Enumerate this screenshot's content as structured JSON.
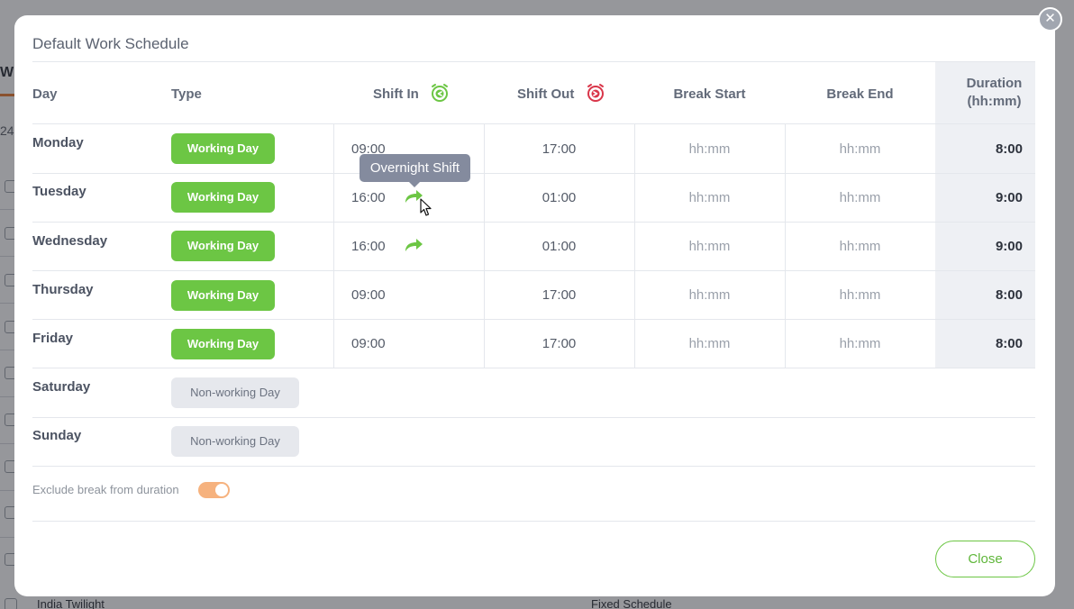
{
  "background": {
    "tab_letter": "W",
    "count_fragment": "24",
    "bottom_left_text": "India Twilight",
    "bottom_right_text": "Fixed Schedule"
  },
  "modal": {
    "title": "Default Work Schedule",
    "close_x": "✕",
    "close_button": "Close"
  },
  "columns": {
    "day": "Day",
    "type": "Type",
    "shift_in": "Shift In",
    "shift_out": "Shift Out",
    "break_start": "Break Start",
    "break_end": "Break End",
    "duration_line1": "Duration",
    "duration_line2": "(hh:mm)"
  },
  "rows": [
    {
      "day": "Monday",
      "type": "Working Day",
      "shift_in": "09:00",
      "shift_out": "17:00",
      "break_start": "hh:mm",
      "break_end": "hh:mm",
      "duration": "8:00",
      "overnight": false
    },
    {
      "day": "Tuesday",
      "type": "Working Day",
      "shift_in": "16:00",
      "shift_out": "01:00",
      "break_start": "hh:mm",
      "break_end": "hh:mm",
      "duration": "9:00",
      "overnight": true
    },
    {
      "day": "Wednesday",
      "type": "Working Day",
      "shift_in": "16:00",
      "shift_out": "01:00",
      "break_start": "hh:mm",
      "break_end": "hh:mm",
      "duration": "9:00",
      "overnight": true
    },
    {
      "day": "Thursday",
      "type": "Working Day",
      "shift_in": "09:00",
      "shift_out": "17:00",
      "break_start": "hh:mm",
      "break_end": "hh:mm",
      "duration": "8:00",
      "overnight": false
    },
    {
      "day": "Friday",
      "type": "Working Day",
      "shift_in": "09:00",
      "shift_out": "17:00",
      "break_start": "hh:mm",
      "break_end": "hh:mm",
      "duration": "8:00",
      "overnight": false
    },
    {
      "day": "Saturday",
      "type": "Non-working Day"
    },
    {
      "day": "Sunday",
      "type": "Non-working Day"
    }
  ],
  "tooltip": "Overnight Shift",
  "exclude_break": {
    "label": "Exclude break from duration",
    "enabled": true
  },
  "colors": {
    "working": "#6cc644",
    "nonworking": "#e6e8ed",
    "toggle_on": "#f6b27e",
    "shift_in_icon": "#6cc644",
    "shift_out_icon": "#d9364a"
  },
  "icons": {
    "shift_in": "alarm-clock-in-icon",
    "shift_out": "alarm-clock-out-icon",
    "overnight": "overnight-arrow-icon",
    "close": "close-icon",
    "cursor": "mouse-cursor-icon"
  }
}
